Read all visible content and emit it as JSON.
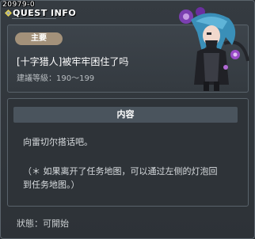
{
  "quest_id": "20979-0",
  "window_title": "QUEST INFO",
  "header": {
    "badge": "主要",
    "quest_name": "[十字猎人]被牢牢困住了吗",
    "level_requirement": "建議等級：190～199"
  },
  "content": {
    "header": "内容",
    "lines": [
      "向雷切尔搭话吧。",
      "（＊ 如果离开了任务地图，可以通过左侧的灯泡回",
      "到任务地图。）"
    ]
  },
  "status": "狀態：可開始",
  "icons": {
    "title": "diamond-bullet-icon",
    "portrait": "npc-portrait"
  },
  "colors": {
    "badge": "#a3917a",
    "panel": "#3d444b",
    "content_header": "#4a545d"
  }
}
